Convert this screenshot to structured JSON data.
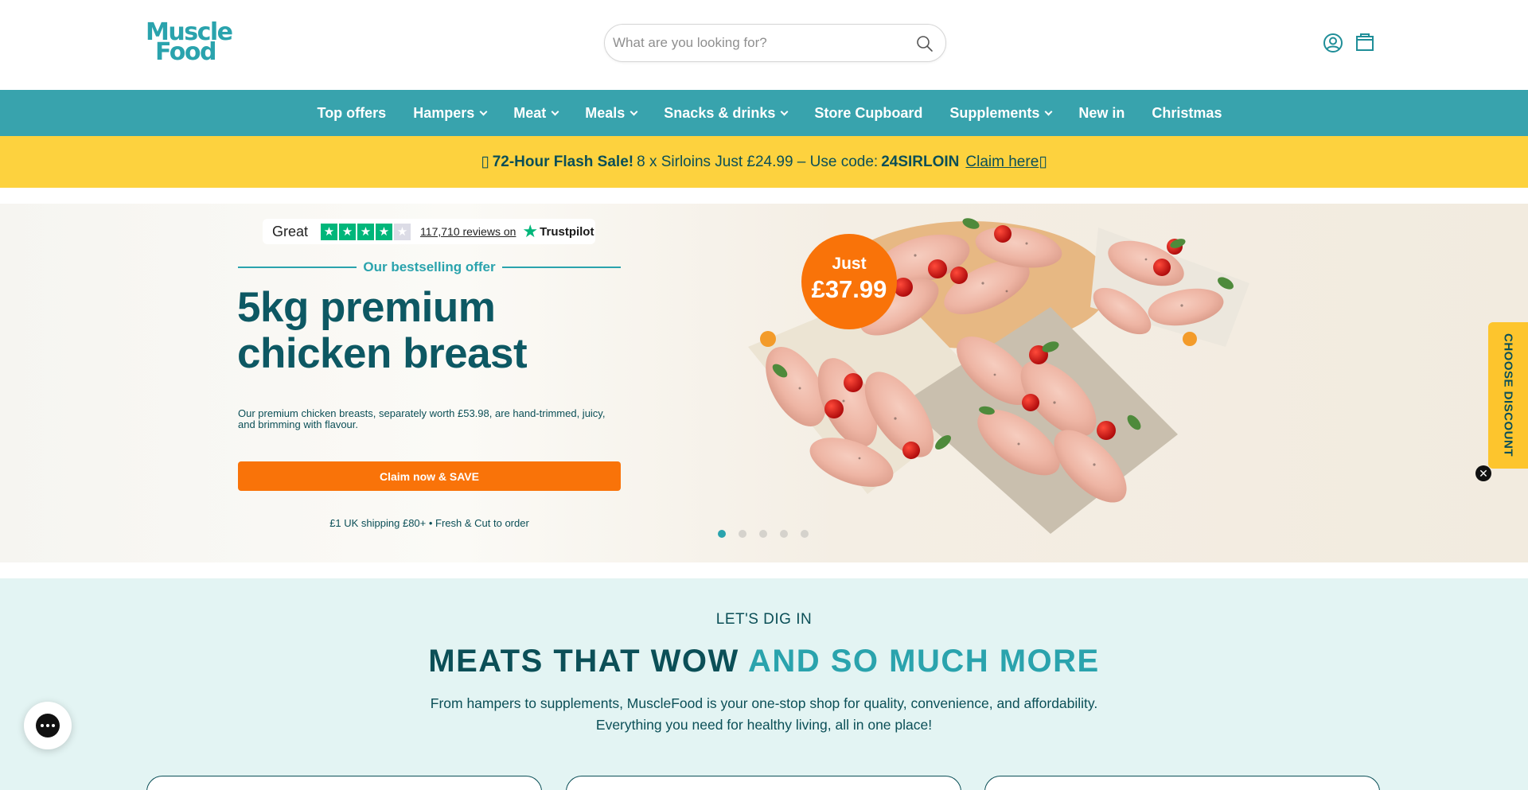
{
  "brand": {
    "logo_line1": "Muscle",
    "logo_line2": "Food",
    "primary_color": "#38a3ad",
    "accent_color": "#f97309",
    "promo_color": "#fdd23e"
  },
  "header": {
    "search_placeholder": "What are you looking for?",
    "search_icon": "search-icon",
    "account_icon": "account-icon",
    "cart_icon": "bag-icon"
  },
  "nav": {
    "items": [
      {
        "label": "Top offers",
        "has_dropdown": false
      },
      {
        "label": "Hampers",
        "has_dropdown": true
      },
      {
        "label": "Meat",
        "has_dropdown": true
      },
      {
        "label": "Meals",
        "has_dropdown": true
      },
      {
        "label": "Snacks & drinks",
        "has_dropdown": true
      },
      {
        "label": "Store Cupboard",
        "has_dropdown": false
      },
      {
        "label": "Supplements",
        "has_dropdown": true
      },
      {
        "label": "New in",
        "has_dropdown": false
      },
      {
        "label": "Christmas",
        "has_dropdown": false
      }
    ]
  },
  "promo": {
    "prefix_glyph": "▯",
    "headline": "72-Hour Flash Sale!",
    "text": "8 x Sirloins Just £24.99 – Use code:",
    "code": "24SIRLOIN",
    "link": "Claim here",
    "suffix_glyph": "▯"
  },
  "hero": {
    "trustpilot": {
      "rating_word": "Great",
      "stars_filled": 4,
      "stars_total": 5,
      "reviews": "117,710 reviews on",
      "brand": "Trustpilot"
    },
    "kicker": "Our bestselling offer",
    "title_line1": "5kg premium",
    "title_line2": "chicken breast",
    "description": "Our premium chicken breasts, separately worth £53.98, are hand-trimmed, juicy, and brimming with flavour.",
    "cta": "Claim now & SAVE",
    "shipping": "£1 UK shipping £80+ • Fresh & Cut to order",
    "price_label": "Just",
    "price": "£37.99",
    "slides_total": 5,
    "slide_active": 1
  },
  "side_tab": {
    "label": "CHOOSE DISCOUNT",
    "close": "✕"
  },
  "section": {
    "kicker": "LET'S DIG IN",
    "title_part1": "MEATS THAT WOW",
    "title_part2": "AND SO MUCH MORE",
    "line1": "From hampers to supplements, MuscleFood is your one-stop shop for quality, convenience, and affordability.",
    "line2": "Everything you need for healthy living, all in one place!"
  },
  "chat": {
    "icon": "chat-icon"
  }
}
